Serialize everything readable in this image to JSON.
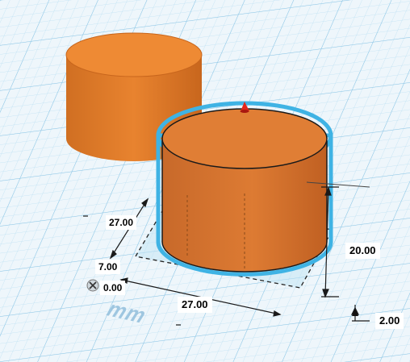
{
  "viewport": {
    "grid_color": "#9fd0ec",
    "background_color": "#eef6fb",
    "shape_color": "#e8832f",
    "selection_color": "#3fb3e4",
    "units": "mm"
  },
  "shapes": [
    {
      "name": "cylinder",
      "selected": false
    },
    {
      "name": "cylinder",
      "selected": true
    }
  ],
  "dimensions": {
    "depth": "27.00",
    "width": "27.00",
    "height": "20.00",
    "elevation": "2.00",
    "offset_x": "7.00",
    "offset_y": "0.00"
  },
  "icons": [
    "close-icon",
    "rotate-handle-icon",
    "lift-arrow-icon"
  ]
}
